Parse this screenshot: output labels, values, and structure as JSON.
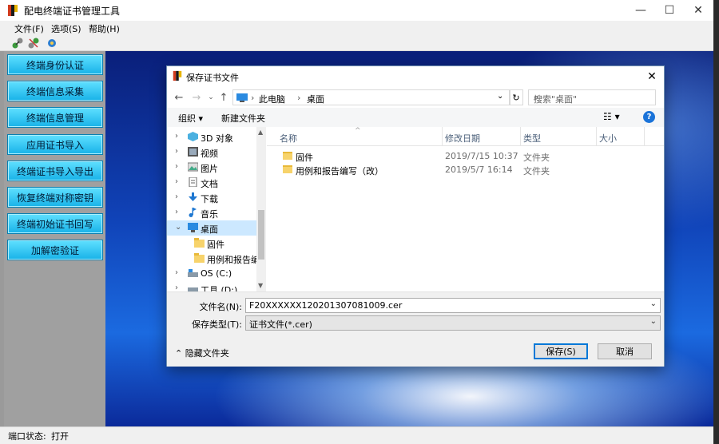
{
  "app": {
    "title": "配电终端证书管理工具",
    "menu": [
      "文件(F)",
      "选项(S)",
      "帮助(H)"
    ],
    "nav_buttons": [
      "终端身份认证",
      "终端信息采集",
      "终端信息管理",
      "应用证书导入",
      "终端证书导入导出",
      "恢复终端对称密钥",
      "终端初始证书回写",
      "加解密验证"
    ],
    "status": {
      "label": "端口状态:",
      "value": "打开"
    }
  },
  "dialog": {
    "title": "保存证书文件",
    "breadcrumb": [
      "此电脑",
      "桌面"
    ],
    "search_placeholder": "搜索\"桌面\"",
    "organize": "组织 ▾",
    "new_folder": "新建文件夹",
    "tree": [
      {
        "label": "3D 对象",
        "icon": "3d-objects-icon"
      },
      {
        "label": "视频",
        "icon": "video-icon"
      },
      {
        "label": "图片",
        "icon": "pictures-icon"
      },
      {
        "label": "文档",
        "icon": "documents-icon"
      },
      {
        "label": "下载",
        "icon": "download-icon"
      },
      {
        "label": "音乐",
        "icon": "music-icon"
      },
      {
        "label": "桌面",
        "icon": "desktop-icon"
      },
      {
        "label": "固件",
        "icon": "folder-icon"
      },
      {
        "label": "用例和报告编写",
        "icon": "folder-icon"
      },
      {
        "label": "OS (C:)",
        "icon": "drive-icon"
      },
      {
        "label": "工具 (D:)",
        "icon": "drive-icon"
      }
    ],
    "columns": [
      "名称",
      "修改日期",
      "类型",
      "大小"
    ],
    "files": [
      {
        "name": "固件",
        "date": "2019/7/15 10:37",
        "type": "文件夹"
      },
      {
        "name": "用例和报告编写（改）",
        "date": "2019/5/7 16:14",
        "type": "文件夹"
      }
    ],
    "filename_label": "文件名(N):",
    "filename_value": "F20XXXXXX120201307081009.cer",
    "filetype_label": "保存类型(T):",
    "filetype_value": "证书文件(*.cer)",
    "hide_folders": "隐藏文件夹",
    "save": "保存(S)",
    "cancel": "取消"
  }
}
